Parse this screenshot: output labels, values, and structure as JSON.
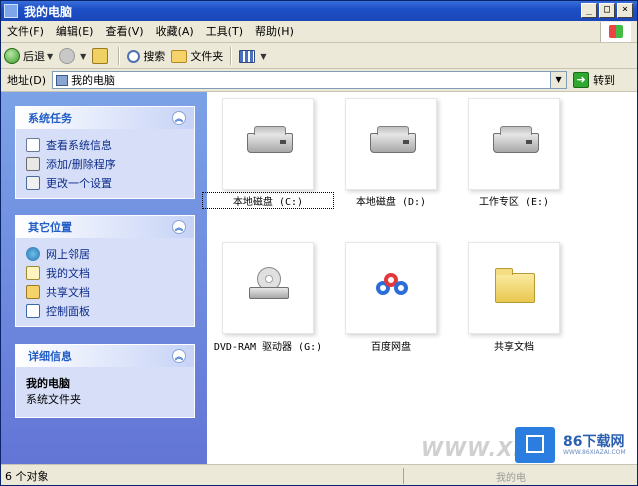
{
  "window": {
    "title": "我的电脑"
  },
  "title_buttons": {
    "minimize": "_",
    "maximize": "□",
    "close": "×"
  },
  "menu": [
    "文件(F)",
    "编辑(E)",
    "查看(V)",
    "收藏(A)",
    "工具(T)",
    "帮助(H)"
  ],
  "toolbar": {
    "back": "后退",
    "search": "搜索",
    "folders": "文件夹"
  },
  "address": {
    "label": "地址(D)",
    "value": "我的电脑",
    "go": "转到"
  },
  "panels": {
    "system_tasks": {
      "title": "系统任务",
      "items": [
        "查看系统信息",
        "添加/删除程序",
        "更改一个设置"
      ]
    },
    "other_places": {
      "title": "其它位置",
      "items": [
        "网上邻居",
        "我的文档",
        "共享文档",
        "控制面板"
      ]
    },
    "details": {
      "title": "详细信息",
      "name": "我的电脑",
      "type": "系统文件夹"
    }
  },
  "drives": [
    {
      "label": "本地磁盘 (C:)",
      "icon": "hard-disk-icon"
    },
    {
      "label": "本地磁盘 (D:)",
      "icon": "hard-disk-icon"
    },
    {
      "label": "工作专区 (E:)",
      "icon": "hard-disk-icon"
    },
    {
      "label": "DVD-RAM 驱动器 (G:)",
      "icon": "dvd-drive-icon"
    },
    {
      "label": "百度网盘",
      "icon": "baidu-netdisk-icon"
    },
    {
      "label": "共享文档",
      "icon": "folder-icon"
    }
  ],
  "status": {
    "left": "6 个对象",
    "right": "我的电"
  },
  "watermark": {
    "xf": "WWW.XF",
    "brand": "86下载网",
    "url": "WWW.86XIAZAI.COM"
  }
}
